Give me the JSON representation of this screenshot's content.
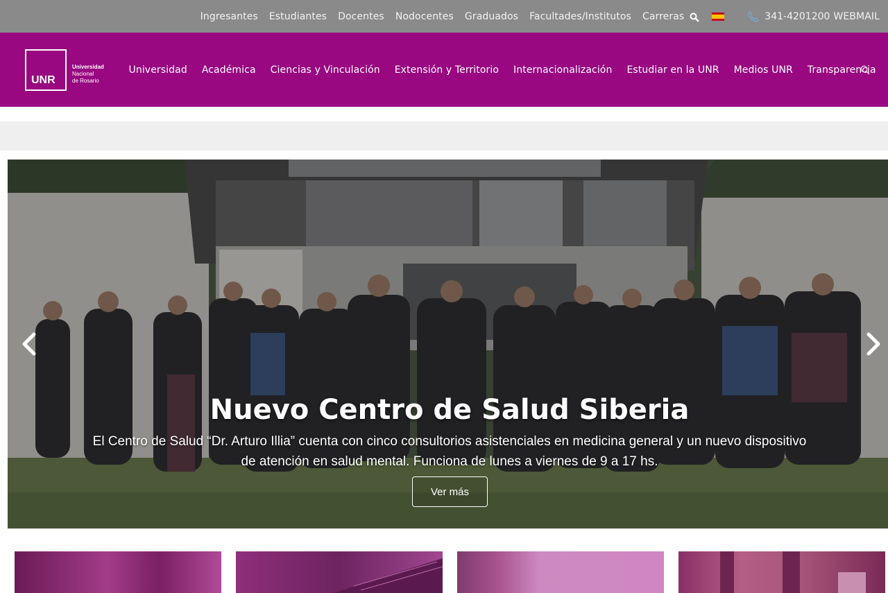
{
  "topbar": {
    "links": [
      "Ingresantes",
      "Estudiantes",
      "Docentes",
      "Nodocentes",
      "Graduados",
      "Facultades/Institutos",
      "Carreras"
    ],
    "phone": "341-4201200",
    "webmail": "WEBMAIL",
    "icons": [
      "search-icon",
      "spain-flag-icon",
      "phone-icon"
    ]
  },
  "logo": {
    "mark": "UNR",
    "line1": "Universidad",
    "line2": "Nacional",
    "line3": "de Rosario"
  },
  "nav": {
    "items": [
      "Universidad",
      "Académica",
      "Ciencias y Vinculación",
      "Extensión y Territorio",
      "Internacionalización",
      "Estudiar en la UNR",
      "Medios UNR",
      "Transparencia"
    ]
  },
  "hero": {
    "title": "Nuevo Centro de Salud Siberia",
    "text": "El Centro de Salud “Dr. Arturo Illia” cuenta con cinco consultorios asistenciales en medicina general y un nuevo dispositivo de atención en salud mental. Funciona de lunes a viernes de 9 a 17 hs.",
    "button": "Ver más",
    "image_sign": "Centro de Salud Dr. Arturo Illia"
  },
  "colors": {
    "topbar": "#8a8a8a",
    "brand": "#990880",
    "band": "#efefef"
  }
}
